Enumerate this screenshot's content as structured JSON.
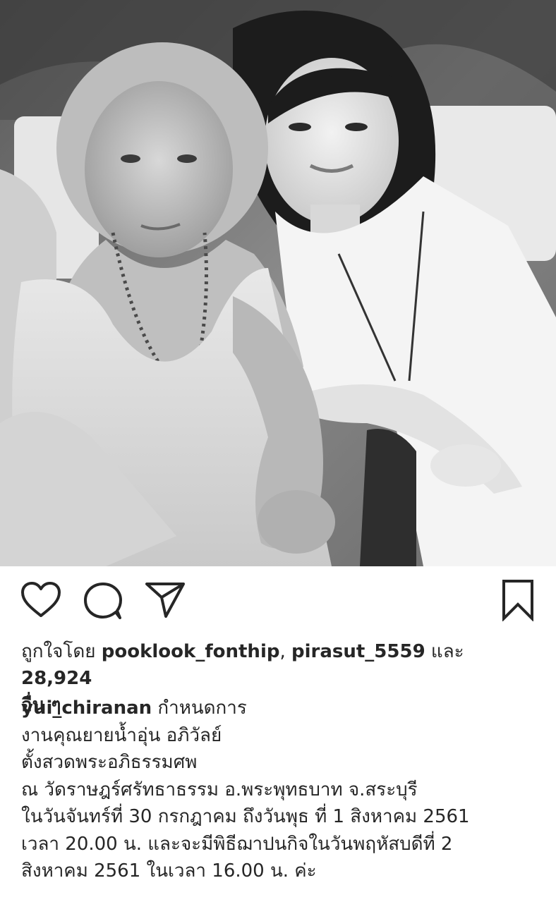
{
  "post": {
    "photo_alt": "Black and white photo of an elderly woman and a young woman sitting together",
    "actions": {
      "like_icon": "heart-icon",
      "comment_icon": "comment-icon",
      "share_icon": "send-icon",
      "save_icon": "bookmark-icon"
    },
    "likes": {
      "prefix": "ถูกใจโดย ",
      "user1": "pooklook_fonthip",
      "sep": ", ",
      "user2": "pirasut_5559",
      "and": " และ ",
      "count": "28,924",
      "suffix": "อื่น ๆ"
    },
    "caption": {
      "username": "yui_chiranan",
      "lines": [
        " กำหนดการ",
        "งานคุณยายน้ำอุ่น อภิวัลย์",
        "ตั้งสวดพระอภิธรรมศพ",
        "ณ วัดราษฎร์ศรัทธาธรรม อ.พระพุทธบาท จ.สระบุรี",
        "ในวันจันทร์ที่ 30 กรกฎาคม ถึงวันพุธ ที่ 1 สิงหาคม 2561",
        "เวลา 20.00 น. และจะมีพิธีฌาปนกิจในวันพฤหัสบดีที่ 2",
        "สิงหาคม 2561 ในเวลา 16.00 น. ค่ะ"
      ]
    }
  }
}
